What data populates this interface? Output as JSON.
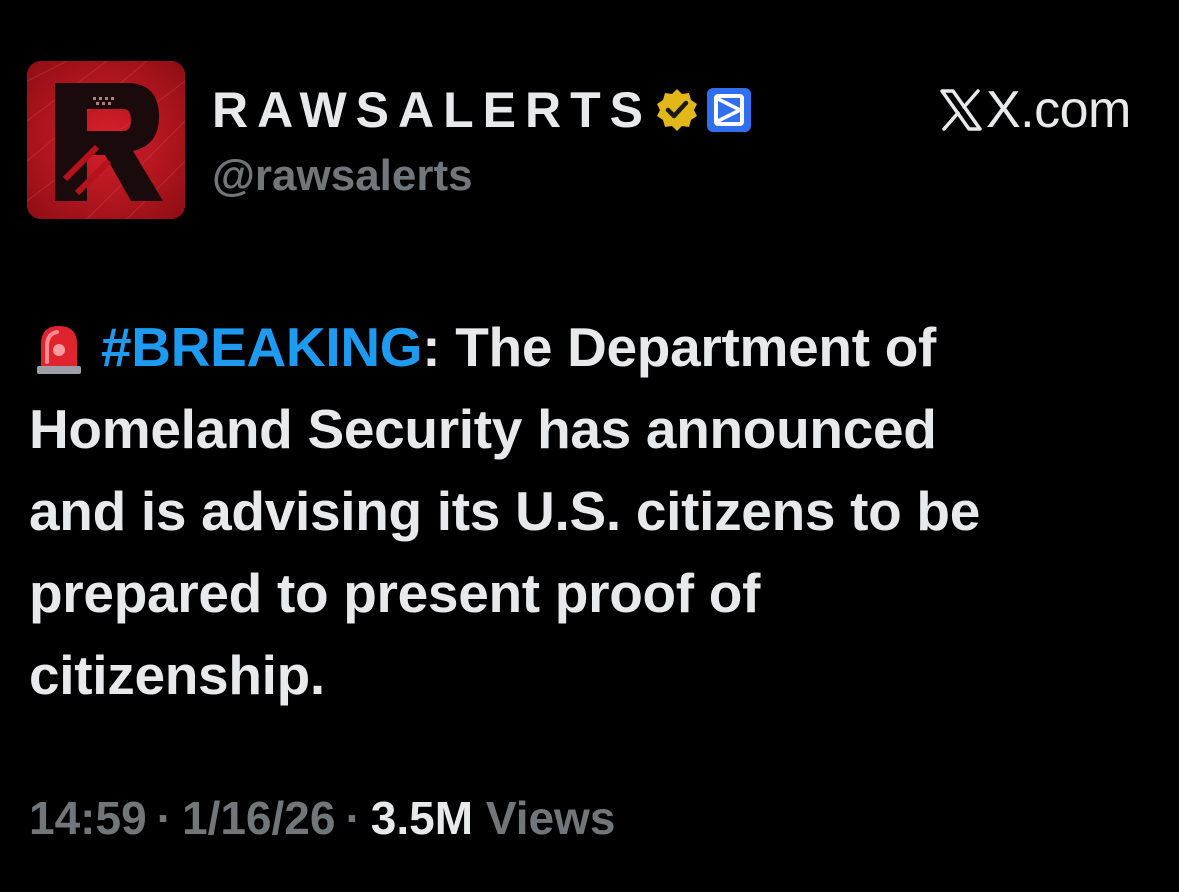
{
  "account": {
    "display_name": "RAWSALERTS",
    "handle": "@rawsalerts",
    "avatar_icon": "raws-logo-icon",
    "verified_icon": "verified-badge-icon",
    "affiliate_icon": "affiliate-badge-icon"
  },
  "source": {
    "label": "X.com",
    "icon": "x-logo-icon"
  },
  "post": {
    "emoji_icon": "siren-icon",
    "hashtag": "#BREAKING",
    "line1_rest": ": The Department of",
    "line2": "Homeland Security has announced",
    "line3": "and is advising its U.S. citizens to be",
    "line4": "prepared to present proof of",
    "line5": "citizenship."
  },
  "meta": {
    "time": "14:59",
    "separator": "·",
    "date": "1/16/26",
    "views_count": "3.5M",
    "views_label": "Views"
  },
  "colors": {
    "background": "#000000",
    "text": "#e7e9ea",
    "muted": "#71767b",
    "hashtag": "#1d9bf0",
    "verified_gold": "#e2b719",
    "affiliate_blue": "#2f6ff0",
    "avatar_red": "#b5121b"
  }
}
